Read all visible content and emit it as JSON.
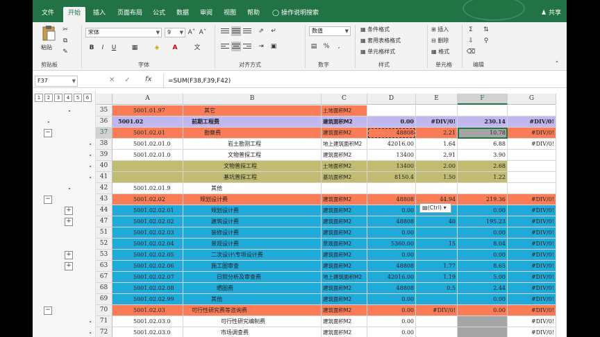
{
  "tabs": [
    "文件",
    "开始",
    "插入",
    "页面布局",
    "公式",
    "数据",
    "审阅",
    "视图",
    "帮助"
  ],
  "tell_me": "操作说明搜索",
  "share": "共享",
  "ribbon": {
    "clipboard": {
      "paste": "粘贴",
      "label": "剪贴板"
    },
    "font": {
      "name": "宋体",
      "size": "9",
      "bold": "B",
      "italic": "I",
      "underline": "U",
      "label": "字体"
    },
    "alignment": {
      "label": "对齐方式"
    },
    "number": {
      "format": "数值",
      "label": "数字"
    },
    "styles": {
      "conditional": "条件格式",
      "table": "套用表格格式",
      "cell": "单元格样式",
      "label": "样式"
    },
    "cells": {
      "insert": "插入",
      "delete": "删除",
      "format": "格式",
      "label": "单元格"
    },
    "editing": {
      "label": "编辑"
    }
  },
  "formula_bar": {
    "name_box": "F37",
    "fx": "fx",
    "formula": "=SUM(F38,F39,F42)"
  },
  "outline_levels": [
    "1",
    "2",
    "3",
    "4",
    "5",
    "6"
  ],
  "columns": [
    "A",
    "B",
    "C",
    "D",
    "E",
    "F",
    "G"
  ],
  "selected_column": "F",
  "colors": {
    "orange": "#fb7d58",
    "purple": "#c0b7f0",
    "olive": "#c0bd73",
    "blue": "#20a9d9",
    "green_cell": "#a9d08e",
    "gray_cell": "#a6a6a6",
    "excel_green": "#217346"
  },
  "rows": [
    {
      "num": "35",
      "a": "5001.01.97",
      "b": "其它",
      "c": "土地面积M2",
      "d": "",
      "e": "",
      "f": "",
      "g": ""
    },
    {
      "num": "36",
      "a": "5001.02",
      "b": "前期工程费",
      "c": "建筑面积M2",
      "d": "0.00",
      "e": "#DIV/0!",
      "f": "230.14",
      "g": "#DIV/0!"
    },
    {
      "num": "37",
      "a": "5001.02.01",
      "b": "勘察费",
      "c": "建筑面积M2",
      "d": "48808",
      "e": "2.21",
      "f": "10.78",
      "g": "#DIV/0!"
    },
    {
      "num": "38",
      "a": "5001.02.01.0",
      "b": "岩土勘测工程",
      "c": "地上建筑面积M2",
      "d": "42016.00",
      "e": "1.64",
      "f": "6.88",
      "g": "#DIV/0!"
    },
    {
      "num": "39",
      "a": "5001.02.01.0",
      "b": "文物普探工程",
      "c": "建筑面积M2",
      "d": "13400",
      "e": "2.91",
      "f": "3.90",
      "g": ""
    },
    {
      "num": "40",
      "a": "",
      "b": "文物普探工程",
      "c": "土地面积M2",
      "d": "13400",
      "e": "2.00",
      "f": "2.68",
      "g": ""
    },
    {
      "num": "41",
      "a": "",
      "b": "基坑普探工程",
      "c": "基坑面积M2",
      "d": "8150.4",
      "e": "1.50",
      "f": "1.22",
      "g": ""
    },
    {
      "num": "42",
      "a": "5001.02.01.9",
      "b": "其他",
      "c": "",
      "d": "",
      "e": "",
      "f": "",
      "g": ""
    },
    {
      "num": "43",
      "a": "5001.02.02",
      "b": "规划设计费",
      "c": "建筑面积M2",
      "d": "48808",
      "e": "44.94",
      "f": "219.36",
      "g": "#DIV/0!"
    },
    {
      "num": "44",
      "a": "5001.02.02.01",
      "b": "规划设计费",
      "c": "建筑面积M2",
      "d": "0.00",
      "e": "",
      "f": "0.00",
      "g": "#DIV/0!"
    },
    {
      "num": "47",
      "a": "5001.02.02.02",
      "b": "建筑设计费",
      "c": "建筑面积M2",
      "d": "48808",
      "e": "40",
      "f": "195.23",
      "g": "#DIV/0!"
    },
    {
      "num": "51",
      "a": "5001.02.02.03",
      "b": "装修设计费",
      "c": "建筑面积M2",
      "d": "0.00",
      "e": "",
      "f": "0.00",
      "g": "#DIV/0!"
    },
    {
      "num": "52",
      "a": "5001.02.02.04",
      "b": "景观设计费",
      "c": "景观面积M2",
      "d": "5360.00",
      "e": "15",
      "f": "8.04",
      "g": "#DIV/0!"
    },
    {
      "num": "53",
      "a": "5001.02.02.05",
      "b": "二次设计\\专项设计费",
      "c": "建筑面积M2",
      "d": "0.00",
      "e": "",
      "f": "0.00",
      "g": "#DIV/0!"
    },
    {
      "num": "63",
      "a": "5001.02.02.06",
      "b": "施工图审查",
      "c": "建筑面积M2",
      "d": "48808",
      "e": "1.77",
      "f": "8.65",
      "g": "#DIV/0!"
    },
    {
      "num": "67",
      "a": "5001.02.02.07",
      "b": "日照分析及审查费",
      "c": "地上建筑面积M2",
      "d": "42016.00",
      "e": "1.19",
      "f": "5.00",
      "g": "#DIV/0!"
    },
    {
      "num": "68",
      "a": "5001.02.02.08",
      "b": "晒图费",
      "c": "建筑面积M2",
      "d": "48808",
      "e": "0.5",
      "f": "2.44",
      "g": "#DIV/0!"
    },
    {
      "num": "69",
      "a": "5001.02.02.99",
      "b": "其他",
      "c": "建筑面积M2",
      "d": "0.00",
      "e": "",
      "f": "0.00",
      "g": "#DIV/0!"
    },
    {
      "num": "70",
      "a": "5001.02.03",
      "b": "可行性研究费等咨询费",
      "c": "建筑面积M2",
      "d": "0.00",
      "e": "#DIV/0!",
      "f": "0.00",
      "g": "#DIV/0!"
    },
    {
      "num": "71",
      "a": "5001.02.03.0",
      "b": "可行性研究编制费",
      "c": "建筑面积M2",
      "d": "0.00",
      "e": "",
      "f": "",
      "g": "#DIV/0!"
    },
    {
      "num": "72",
      "a": "5001.02.03.0",
      "b": "市场调查费",
      "c": "建筑面积M2",
      "d": "0.00",
      "e": "",
      "f": "",
      "g": "#DIV/0!"
    },
    {
      "num": "73",
      "a": "",
      "b": "",
      "c": "",
      "d": "",
      "e": "",
      "f": "",
      "g": ""
    }
  ],
  "paste_options": "(Ctrl)"
}
